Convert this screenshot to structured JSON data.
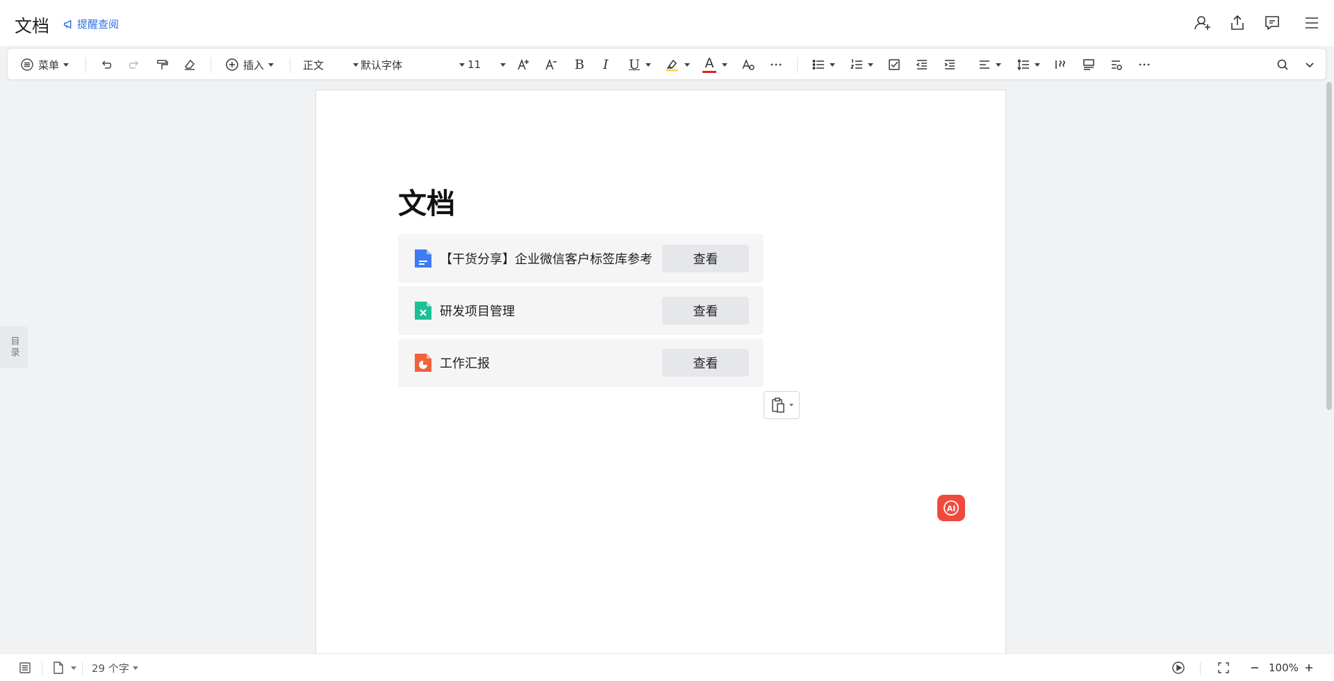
{
  "header": {
    "title": "文档",
    "reminder_label": "提醒查阅",
    "icons": [
      "add-collaborator-icon",
      "share-icon",
      "comment-icon",
      "more-menu-icon"
    ]
  },
  "toolbar": {
    "menu_label": "菜单",
    "insert_label": "插入",
    "style_value": "正文",
    "font_value": "默认字体",
    "size_value": "11",
    "bold_glyph": "B",
    "italic_glyph": "I",
    "underline_glyph": "U",
    "font_color_glyph": "A",
    "highlight_color": "#f5d53a",
    "font_color": "#e02020"
  },
  "document": {
    "heading": "文档",
    "cards": [
      {
        "label": "【干货分享】企业微信客户标签库参考",
        "button": "查看",
        "icon": "doc-file-icon",
        "color": "#3d7bf2"
      },
      {
        "label": "研发项目管理",
        "button": "查看",
        "icon": "sheet-file-icon",
        "color": "#1fbf95"
      },
      {
        "label": "工作汇报",
        "button": "查看",
        "icon": "slides-file-icon",
        "color": "#f0623a"
      }
    ],
    "ai_label": "AI"
  },
  "sidebar": {
    "toc_label": "目录"
  },
  "status": {
    "word_count": "29 个字",
    "zoom": "100%"
  }
}
